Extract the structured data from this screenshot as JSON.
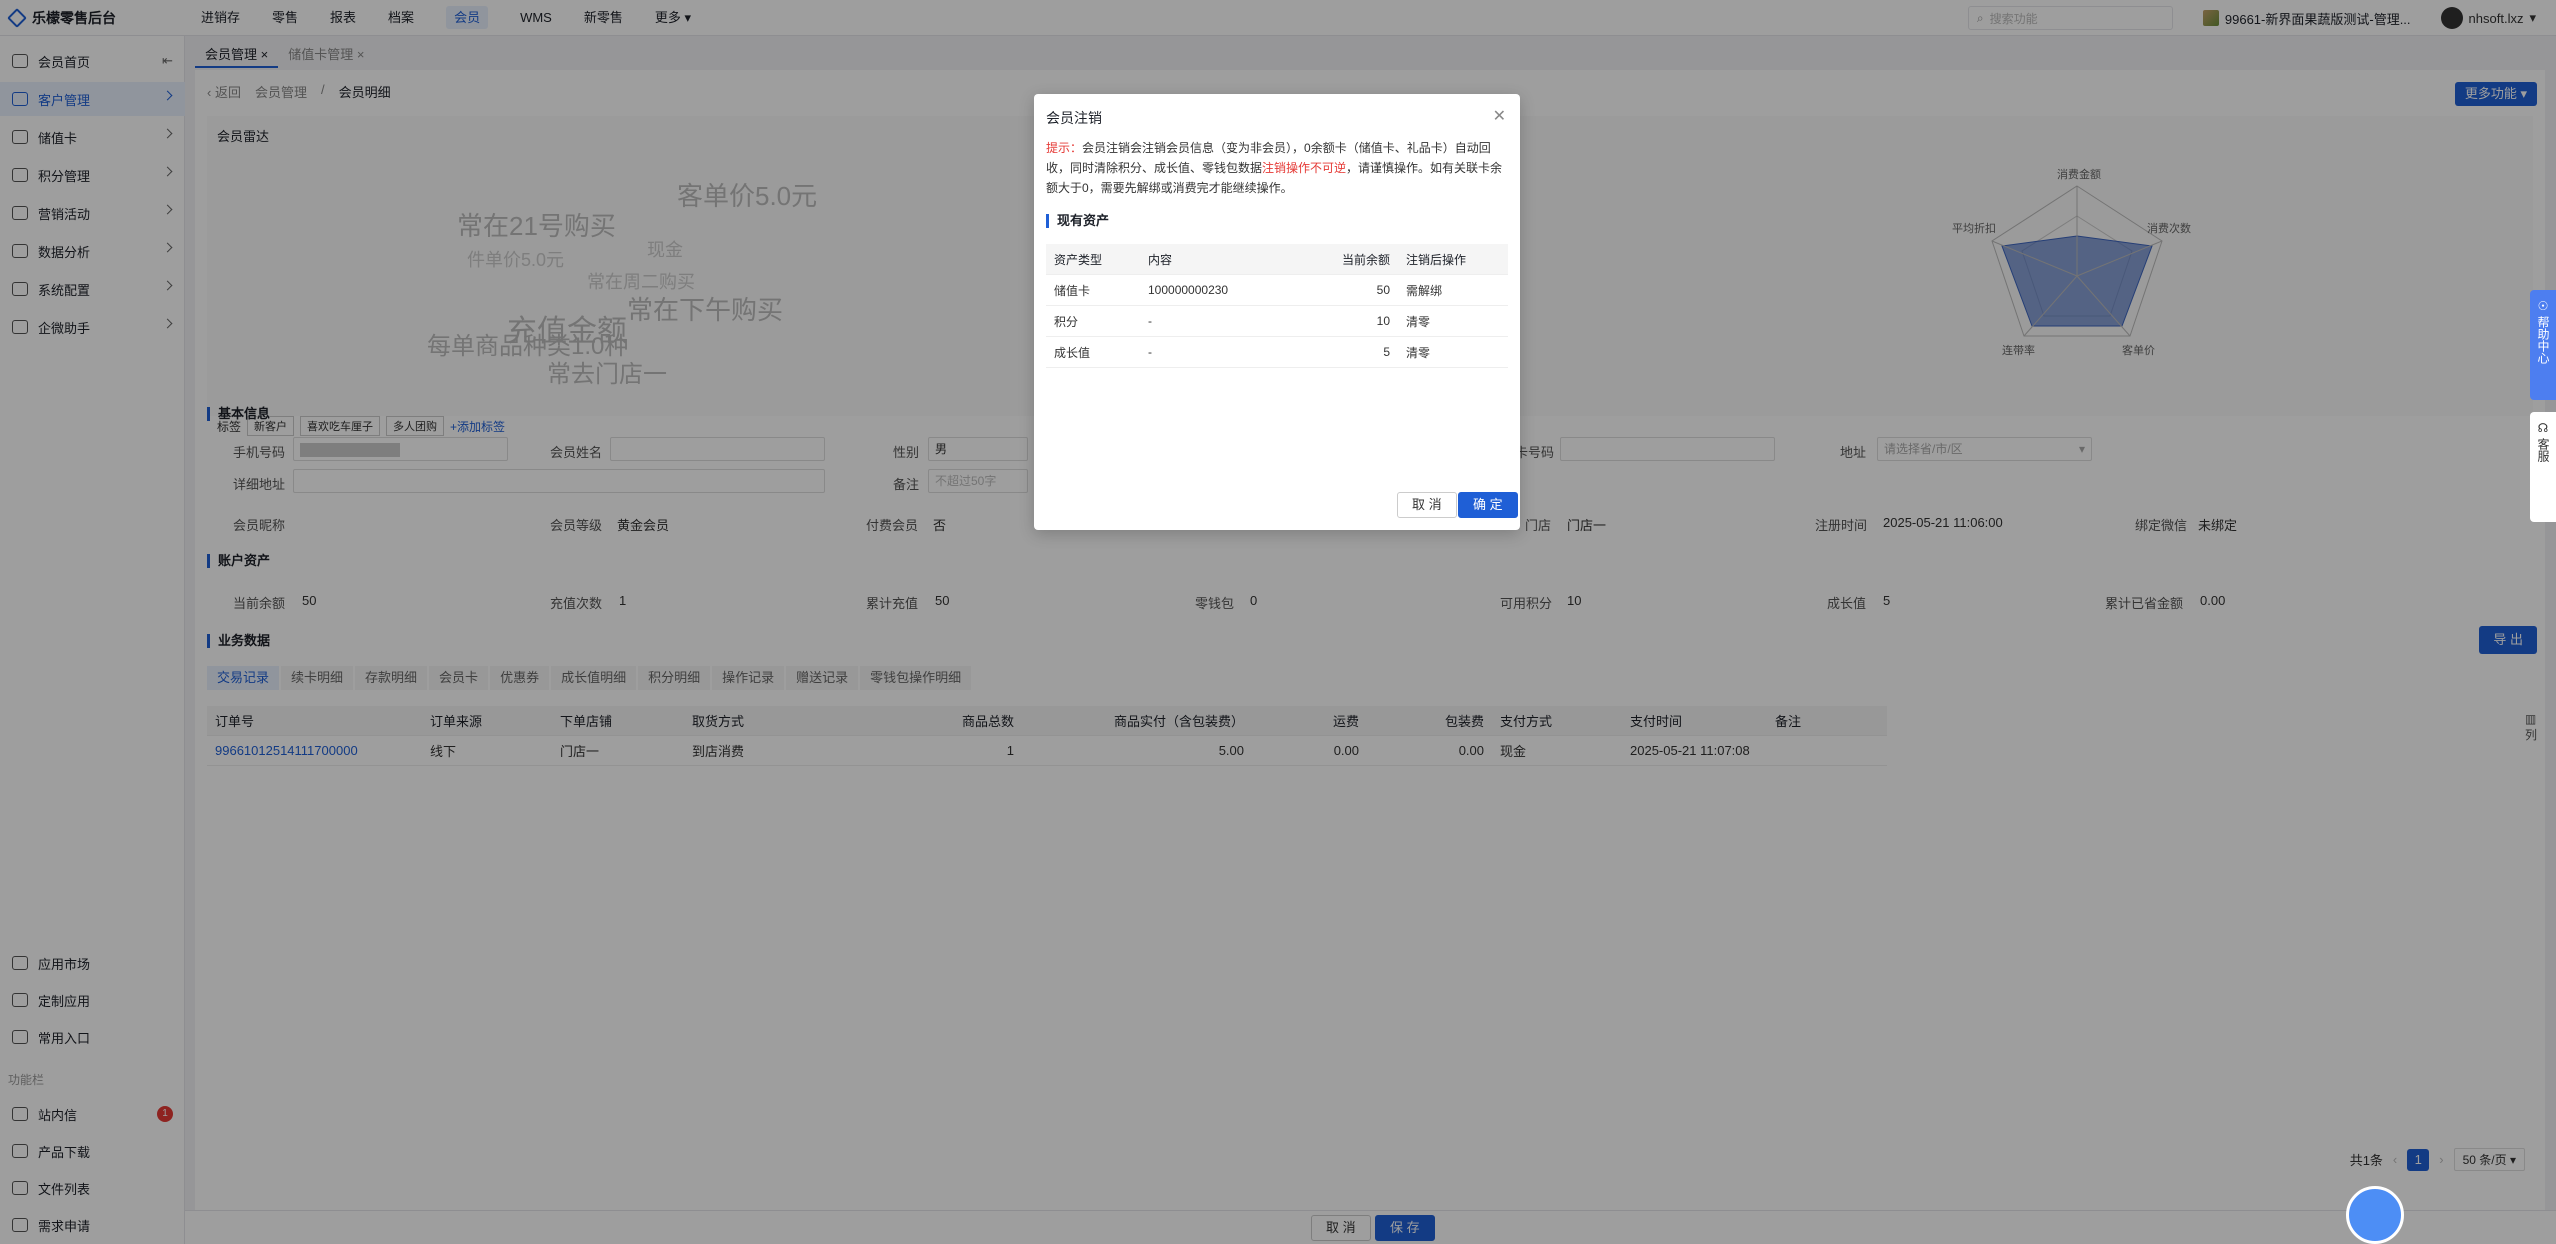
{
  "app": {
    "title": "乐檬零售后台"
  },
  "topnav": [
    {
      "label": "进销存",
      "active": false
    },
    {
      "label": "零售",
      "active": false
    },
    {
      "label": "报表",
      "active": false
    },
    {
      "label": "档案",
      "active": false
    },
    {
      "label": "会员",
      "active": true
    },
    {
      "label": "WMS",
      "active": false
    },
    {
      "label": "新零售",
      "active": false
    },
    {
      "label": "更多",
      "active": false
    }
  ],
  "topright": {
    "search_placeholder": "搜索功能",
    "store": "99661-新界面果蔬版测试-管理...",
    "user": "nhsoft.lxz"
  },
  "sidebar": {
    "items": [
      {
        "label": "会员首页"
      },
      {
        "label": "客户管理"
      },
      {
        "label": "储值卡"
      },
      {
        "label": "积分管理"
      },
      {
        "label": "营销活动"
      },
      {
        "label": "数据分析"
      },
      {
        "label": "系统配置"
      },
      {
        "label": "企微助手"
      }
    ],
    "bottom_items": [
      {
        "label": "应用市场"
      },
      {
        "label": "定制应用"
      },
      {
        "label": "常用入口"
      }
    ],
    "group_label": "功能栏",
    "func_items": [
      {
        "label": "站内信",
        "badge": "1"
      },
      {
        "label": "产品下载"
      },
      {
        "label": "文件列表"
      },
      {
        "label": "需求申请"
      }
    ]
  },
  "tabs": [
    {
      "label": "会员管理 ×"
    },
    {
      "label": "储值卡管理 ×"
    }
  ],
  "breadcrumb": {
    "back": "返回",
    "parent": "会员管理",
    "current": "会员明细"
  },
  "more_button": "更多功能",
  "radar": {
    "title": "会员雷达",
    "cloud": [
      "常在21号购买",
      "客单价5.0元",
      "现金",
      "件单价5.0元",
      "充值金额",
      "常在下午购买",
      "常在周二购买",
      "每单商品种类1.0种",
      "常去门店一"
    ],
    "axes": [
      "消费金额",
      "消费次数",
      "客单价",
      "连带率",
      "平均折扣"
    ]
  },
  "tags": {
    "label": "标签",
    "items": [
      "新客户",
      "喜欢吃车厘子",
      "多人团购"
    ],
    "add": "+添加标签"
  },
  "basic": {
    "title": "基本信息",
    "phone_label": "手机号码",
    "name_label": "会员姓名",
    "gender_label": "性别",
    "gender_value": "男",
    "card_label": "卡号码",
    "address_label": "地址",
    "address_placeholder": "请选择省/市/区",
    "detail_label": "详细地址",
    "remark_label": "备注",
    "remark_placeholder": "不超过50字",
    "nick_label": "会员昵称",
    "level_label": "会员等级",
    "level_value": "黄金会员",
    "paid_label": "付费会员",
    "paid_value": "否",
    "store_label": "门店",
    "store_value": "门店一",
    "regtime_label": "注册时间",
    "regtime_value": "2025-05-21 11:06:00",
    "wx_label": "绑定微信",
    "wx_value": "未绑定"
  },
  "account": {
    "title": "账户资产",
    "items": [
      {
        "label": "当前余额",
        "value": "50"
      },
      {
        "label": "充值次数",
        "value": "1"
      },
      {
        "label": "累计充值",
        "value": "50"
      },
      {
        "label": "零钱包",
        "value": "0"
      },
      {
        "label": "可用积分",
        "value": "10"
      },
      {
        "label": "成长值",
        "value": "5"
      },
      {
        "label": "累计已省金额",
        "value": "0.00"
      }
    ]
  },
  "business": {
    "title": "业务数据",
    "export": "导 出",
    "subtabs": [
      "交易记录",
      "续卡明细",
      "存款明细",
      "会员卡",
      "优惠券",
      "成长值明细",
      "积分明细",
      "操作记录",
      "赠送记录",
      "零钱包操作明细"
    ],
    "columns": [
      "订单号",
      "订单来源",
      "下单店铺",
      "取货方式",
      "商品总数",
      "商品实付（含包装费）",
      "运费",
      "包装费",
      "支付方式",
      "支付时间",
      "备注"
    ],
    "rows": [
      [
        "99661012514111700000",
        "线下",
        "门店一",
        "到店消费",
        "1",
        "5.00",
        "0.00",
        "0.00",
        "现金",
        "2025-05-21 11:07:08",
        ""
      ]
    ],
    "col_setting": "列"
  },
  "pager": {
    "total": "共1条",
    "page": "1",
    "size": "50 条/页"
  },
  "footer": {
    "cancel": "取 消",
    "save": "保 存"
  },
  "floats": {
    "help": "帮助中心",
    "cs": "客服"
  },
  "modal": {
    "title": "会员注销",
    "tip_prefix": "提示：",
    "tip_body": "会员注销会注销会员信息（变为非会员），0余额卡（储值卡、礼品卡）自动回收，同时清除积分、成长值、零钱包数据",
    "tip_red": "注销操作不可逆",
    "tip_tail": "，请谨慎操作。如有关联卡余额大于0，需要先解绑或消费完才能继续操作。",
    "section": "现有资产",
    "columns": [
      "资产类型",
      "内容",
      "当前余额",
      "注销后操作"
    ],
    "rows": [
      [
        "储值卡",
        "100000000230",
        "50",
        "需解绑"
      ],
      [
        "积分",
        "-",
        "10",
        "清零"
      ],
      [
        "成长值",
        "-",
        "5",
        "清零"
      ]
    ],
    "cancel": "取 消",
    "confirm": "确 定"
  },
  "colors": {
    "primary": "#1f5fd6",
    "danger": "#e53935"
  }
}
